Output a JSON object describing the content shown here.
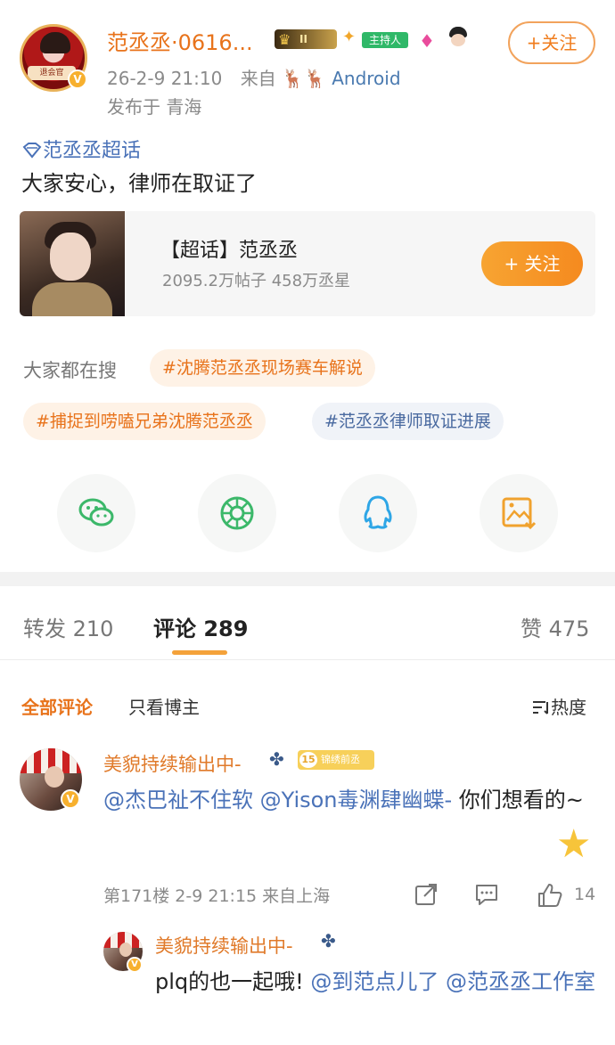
{
  "post": {
    "author": "范丞丞·0616...",
    "rank_badge": "II",
    "host_badge": "主持人",
    "avatar_tag": "退会官",
    "follow_label": "+关注",
    "time": "26-2-9 21:10",
    "source_prefix": "来自",
    "source_deer": "🦌🦌",
    "source": "Android",
    "location": "发布于 青海",
    "topic": "范丞丞超话",
    "text": "大家安心，律师在取证了"
  },
  "topic_card": {
    "title": "【超话】范丞丞",
    "stats": "2095.2万帖子 458万丞星",
    "follow_label": "+ 关注"
  },
  "hot_search": {
    "label": "大家都在搜",
    "tags": [
      "#沈腾范丞丞现场赛车解说",
      "#捕捉到唠嗑兄弟沈腾范丞丞",
      "#范丞丞律师取证进展"
    ]
  },
  "tabs": {
    "repost": "转发 210",
    "comment": "评论 289",
    "like": "赞 475"
  },
  "filters": {
    "all": "全部评论",
    "author_only": "只看博主",
    "sort": "热度"
  },
  "comment": {
    "user": "美貌持续输出中-",
    "fan_level": "15",
    "fan_badge": "锦绣前丞",
    "mention1": "@杰巴祉不住软",
    "mention2": "@Yison毒渊肆幽蝶-",
    "text_tail": " 你们想看的~",
    "meta": "第171楼 2-9 21:15 来自上海",
    "likes": "14"
  },
  "reply": {
    "user": "美貌持续输出中-",
    "text_head": "plq的也一起哦! ",
    "mention1": "@到范点儿了",
    "mention2": "@范丞丞工作室"
  },
  "colors": {
    "accent": "#e8731b",
    "link": "#4a72b8",
    "tab_underline": "#f4a23a"
  }
}
